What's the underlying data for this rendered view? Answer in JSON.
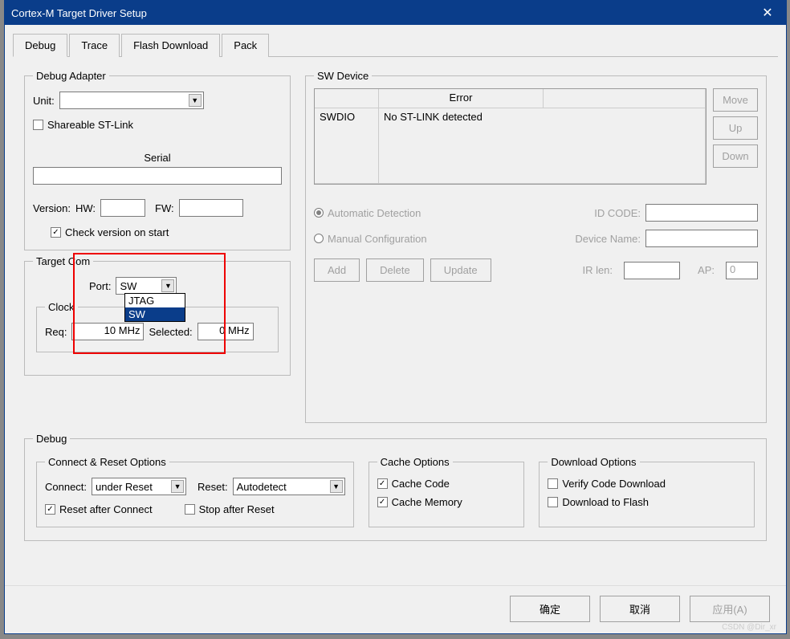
{
  "window": {
    "title": "Cortex-M Target Driver Setup"
  },
  "tabs": [
    "Debug",
    "Trace",
    "Flash Download",
    "Pack"
  ],
  "adapter": {
    "legend": "Debug Adapter",
    "unit_label": "Unit:",
    "unit_value": "",
    "shareable_label": "Shareable ST-Link",
    "shareable_checked": false,
    "serial_label": "Serial",
    "serial_value": "",
    "version_label": "Version:",
    "hw_label": "HW:",
    "hw_value": "",
    "fw_label": "FW:",
    "fw_value": "",
    "check_version_label": "Check version on start",
    "check_version_checked": true
  },
  "target_com": {
    "legend": "Target Com",
    "port_label": "Port:",
    "port_value": "SW",
    "port_options": [
      "JTAG",
      "SW"
    ],
    "port_selected_index": 1,
    "clock_legend": "Clock",
    "req_label": "Req:",
    "req_value": "10 MHz",
    "selected_label": "Selected:",
    "selected_value": "0 MHz"
  },
  "sw_device": {
    "legend": "SW Device",
    "col_blank": "",
    "col_error": "Error",
    "swdio_label": "SWDIO",
    "message": "No ST-LINK detected",
    "btn_move": "Move",
    "btn_up": "Up",
    "btn_down": "Down",
    "auto_label": "Automatic Detection",
    "manual_label": "Manual Configuration",
    "idcode_label": "ID CODE:",
    "idcode_value": "",
    "devname_label": "Device Name:",
    "devname_value": "",
    "btn_add": "Add",
    "btn_delete": "Delete",
    "btn_update": "Update",
    "irlen_label": "IR len:",
    "irlen_value": "",
    "ap_label": "AP:",
    "ap_value": "0"
  },
  "debug": {
    "legend": "Debug",
    "connect_reset_legend": "Connect & Reset Options",
    "connect_label": "Connect:",
    "connect_value": "under Reset",
    "reset_label": "Reset:",
    "reset_value": "Autodetect",
    "reset_after_label": "Reset after Connect",
    "reset_after_checked": true,
    "stop_after_label": "Stop after Reset",
    "stop_after_checked": false,
    "cache_legend": "Cache Options",
    "cache_code_label": "Cache Code",
    "cache_code_checked": true,
    "cache_mem_label": "Cache Memory",
    "cache_mem_checked": true,
    "download_legend": "Download Options",
    "verify_label": "Verify Code Download",
    "verify_checked": false,
    "dl_flash_label": "Download to Flash",
    "dl_flash_checked": false
  },
  "footer": {
    "ok": "确定",
    "cancel": "取消",
    "apply": "应用(A)"
  },
  "watermark": "CSDN @Dir_xr"
}
